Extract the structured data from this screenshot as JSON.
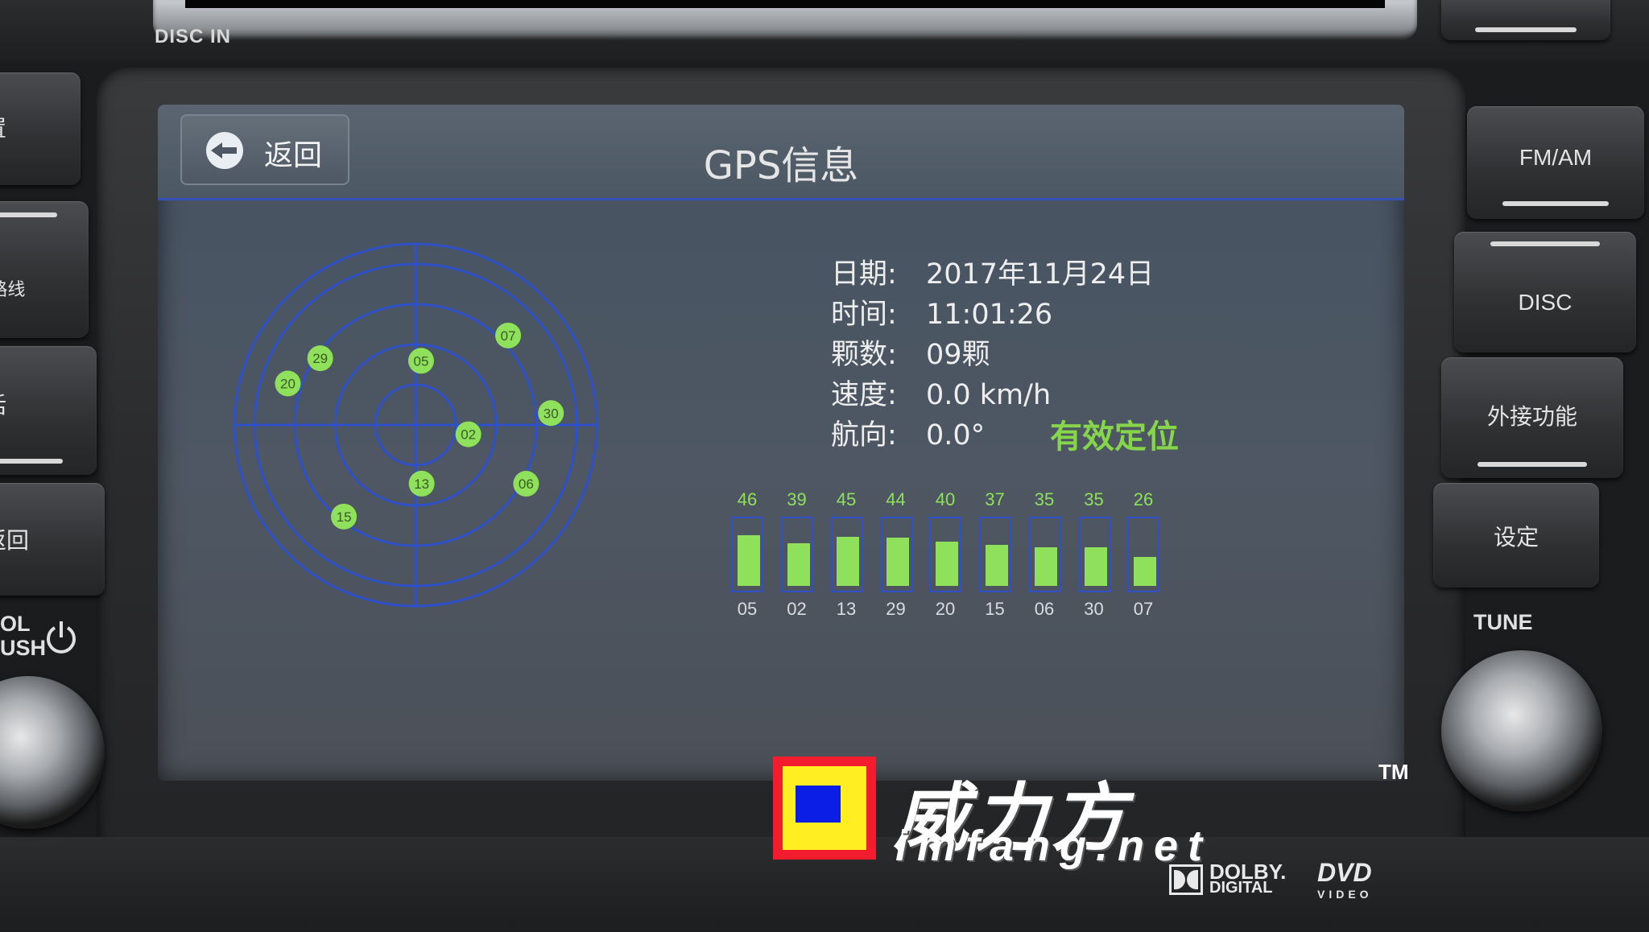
{
  "hardware": {
    "disc_slot_label": "DISC IN",
    "top_right_button_label": "",
    "right_buttons": [
      {
        "label": "FM/AM"
      },
      {
        "label": "DISC"
      },
      {
        "label": "外接功能"
      },
      {
        "label": "设定"
      }
    ],
    "left_buttons": [
      {
        "label": "置"
      },
      {
        "label": "/路线"
      },
      {
        "label": "话"
      },
      {
        "label": "返回"
      }
    ],
    "tune_label": "TUNE",
    "vol_label_line1": "OL",
    "vol_label_line2": "USH",
    "power_icon": "power-icon"
  },
  "screen": {
    "back_label": "返回",
    "title": "GPS信息",
    "info": {
      "date_key": "日期:",
      "date_value": "2017年11月24日",
      "time_key": "时间:",
      "time_value": "11:01:26",
      "count_key": "颗数:",
      "count_value": "09颗",
      "speed_key": "速度:",
      "speed_value": "0.0 km/h",
      "heading_key": "航向:",
      "heading_value": "0.0°",
      "fix_status": "有效定位"
    },
    "colors": {
      "satellite_green": "#8fe05a",
      "grid_blue": "#2e50c8",
      "status_green": "#86d64a"
    }
  },
  "chart_data": {
    "type": "bar",
    "categories": [
      "05",
      "02",
      "13",
      "29",
      "20",
      "15",
      "06",
      "30",
      "07"
    ],
    "values": [
      46,
      39,
      45,
      44,
      40,
      37,
      35,
      35,
      26
    ],
    "ylim": [
      0,
      60
    ]
  },
  "sky_plot": {
    "satellites": [
      {
        "prn": "05",
        "azimuth": 5,
        "elevation": 54
      },
      {
        "prn": "07",
        "azimuth": 46,
        "elevation": 18
      },
      {
        "prn": "30",
        "azimuth": 85,
        "elevation": 14
      },
      {
        "prn": "02",
        "azimuth": 100,
        "elevation": 60
      },
      {
        "prn": "06",
        "azimuth": 118,
        "elevation": 20
      },
      {
        "prn": "13",
        "azimuth": 174,
        "elevation": 57
      },
      {
        "prn": "15",
        "azimuth": 218,
        "elevation": 25
      },
      {
        "prn": "20",
        "azimuth": 288,
        "elevation": 15
      },
      {
        "prn": "29",
        "azimuth": 305,
        "elevation": 25
      }
    ]
  },
  "watermark": {
    "brand": "威力方",
    "tm": "TM",
    "url": "imfang.net",
    "colors": {
      "outer": "#f21c2e",
      "middle": "#ffee22",
      "inner": "#0a1ee6"
    }
  },
  "logos": {
    "dolby_line1": "DOLBY.",
    "dolby_line2": "DIGITAL",
    "dvd_line1": "DVD",
    "dvd_line2": "VIDEO"
  }
}
